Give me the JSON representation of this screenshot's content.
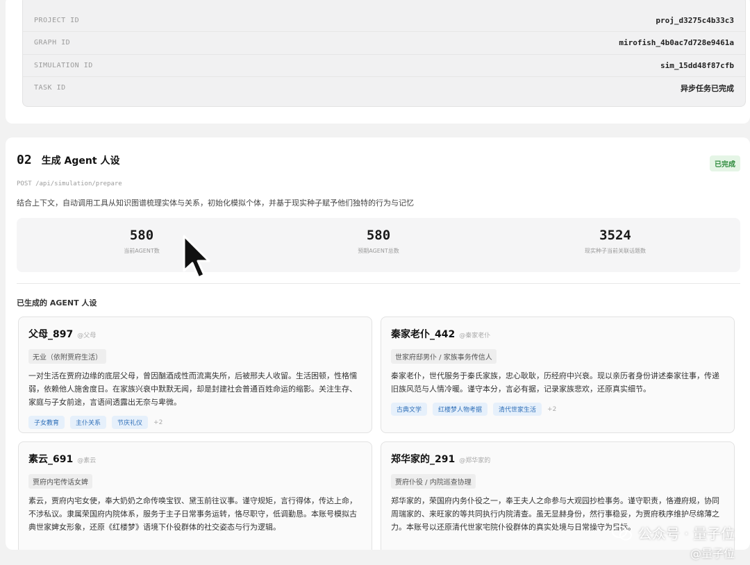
{
  "project_info": {
    "rows": [
      {
        "label": "PROJECT ID",
        "value": "proj_d3275c4b33c3"
      },
      {
        "label": "GRAPH ID",
        "value": "mirofish_4b0ac7d728e9461a"
      },
      {
        "label": "SIMULATION ID",
        "value": "sim_15dd48f87cfb"
      },
      {
        "label": "TASK ID",
        "value": "异步任务已完成"
      }
    ]
  },
  "step": {
    "number": "02",
    "title": "生成 Agent 人设",
    "status": "已完成",
    "endpoint": "POST /api/simulation/prepare",
    "description": "结合上下文，自动调用工具从知识图谱梳理实体与关系，初始化模拟个体，并基于现实种子赋予他们独特的行为与记忆"
  },
  "stats": [
    {
      "value": "580",
      "label": "当前AGENT数"
    },
    {
      "value": "580",
      "label": "预期AGENT总数"
    },
    {
      "value": "3524",
      "label": "现实种子当前关联话题数"
    }
  ],
  "agents_section": {
    "label": "已生成的 AGENT 人设",
    "agents": [
      {
        "name": "父母_897",
        "handle": "@父母",
        "role": "无业（依附贾府生活）",
        "bio": "一对生活在贾府边缘的底层父母，曾因酗酒成性而流离失所，后被邢夫人收留。生活困顿，性格懦弱，依赖他人施舍度日。在家族兴衰中默默无闻，却是封建社会普通百姓命运的缩影。关注生存、家庭与子女前途，言语间透露出无奈与卑微。",
        "tags": [
          "子女教育",
          "主仆关系",
          "节庆礼仪"
        ],
        "more": "+2"
      },
      {
        "name": "秦家老仆_442",
        "handle": "@秦家老仆",
        "role": "世家府邸男仆 / 家族事务传信人",
        "bio": "秦家老仆，世代服务于秦氏家族，忠心耿耿，历经府中兴衰。现以亲历者身份讲述秦家往事，传递旧族风范与人情冷暖。谨守本分，言必有据，记录家族悲欢，还原真实细节。",
        "tags": [
          "古典文学",
          "红楼梦人物考据",
          "清代世家生活"
        ],
        "more": "+2"
      },
      {
        "name": "素云_691",
        "handle": "@素云",
        "role": "贾府内宅传话女婢",
        "bio": "素云，贾府内宅女使，奉大奶奶之命传唤宝钗、黛玉前往议事。谨守规矩，言行得体，传达上命，不涉私议。隶属荣国府内院体系，服务于主子日常事务运转，恪尽职守，低调勤恳。本账号模拟古典世家婢女形象，还原《红楼梦》语境下仆役群体的社交姿态与行为逻辑。",
        "tags": [],
        "more": ""
      },
      {
        "name": "郑华家的_291",
        "handle": "@郑华家的",
        "role": "贾府仆役 / 内院巡查协理",
        "bio": "郑华家的，荣国府内务仆役之一，奉王夫人之命参与大观园抄检事务。谨守职责，恪遵府规，协同周瑞家的、来旺家的等共同执行内院清查。虽无显赫身份，然行事稳妥，为贾府秩序维护尽绵薄之力。本账号以还原清代世家宅院仆役群体的真实处境与日常操守为目标。",
        "tags": [],
        "more": ""
      }
    ]
  },
  "watermark": {
    "line1": "公众号 · 量子位",
    "line2": "@量子位"
  }
}
